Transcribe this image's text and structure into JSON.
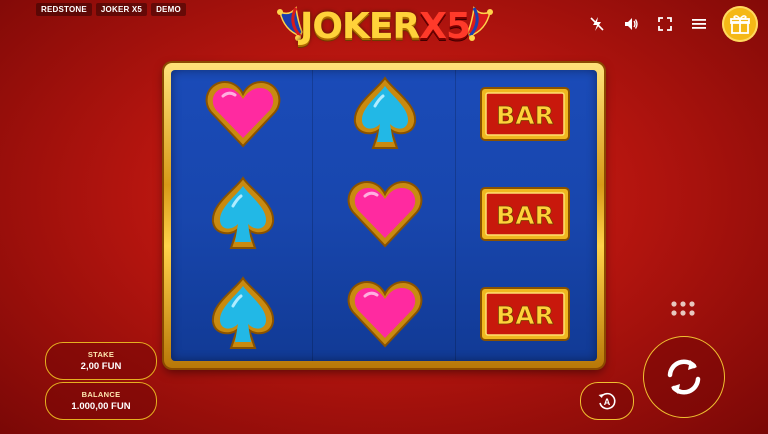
{
  "tags": [
    "REDSTONE",
    "JOKER X5",
    "DEMO"
  ],
  "logo": {
    "main": "JOKER",
    "suffix": "X5"
  },
  "toolbar": {
    "icons": [
      "lightning-off-icon",
      "speaker-icon",
      "fullscreen-icon",
      "menu-icon",
      "gift-icon"
    ]
  },
  "reels": {
    "columns": [
      [
        "heart",
        "spade",
        "spade"
      ],
      [
        "spade",
        "heart",
        "heart"
      ],
      [
        "bar",
        "bar",
        "bar"
      ]
    ],
    "bar_label": "BAR"
  },
  "stake": {
    "label": "STAKE",
    "value": "2,00 FUN"
  },
  "balance": {
    "label": "BALANCE",
    "value": "1.000,00 FUN"
  },
  "controls": {
    "icons": [
      "bet-options-grid-icon",
      "spin-icon",
      "autoplay-icon"
    ]
  },
  "colors": {
    "background": "#c41a12",
    "reel_bg": "#1846ad",
    "gold": "#e6b020",
    "heart": "#ff2aa0",
    "spade": "#22b8e6"
  }
}
